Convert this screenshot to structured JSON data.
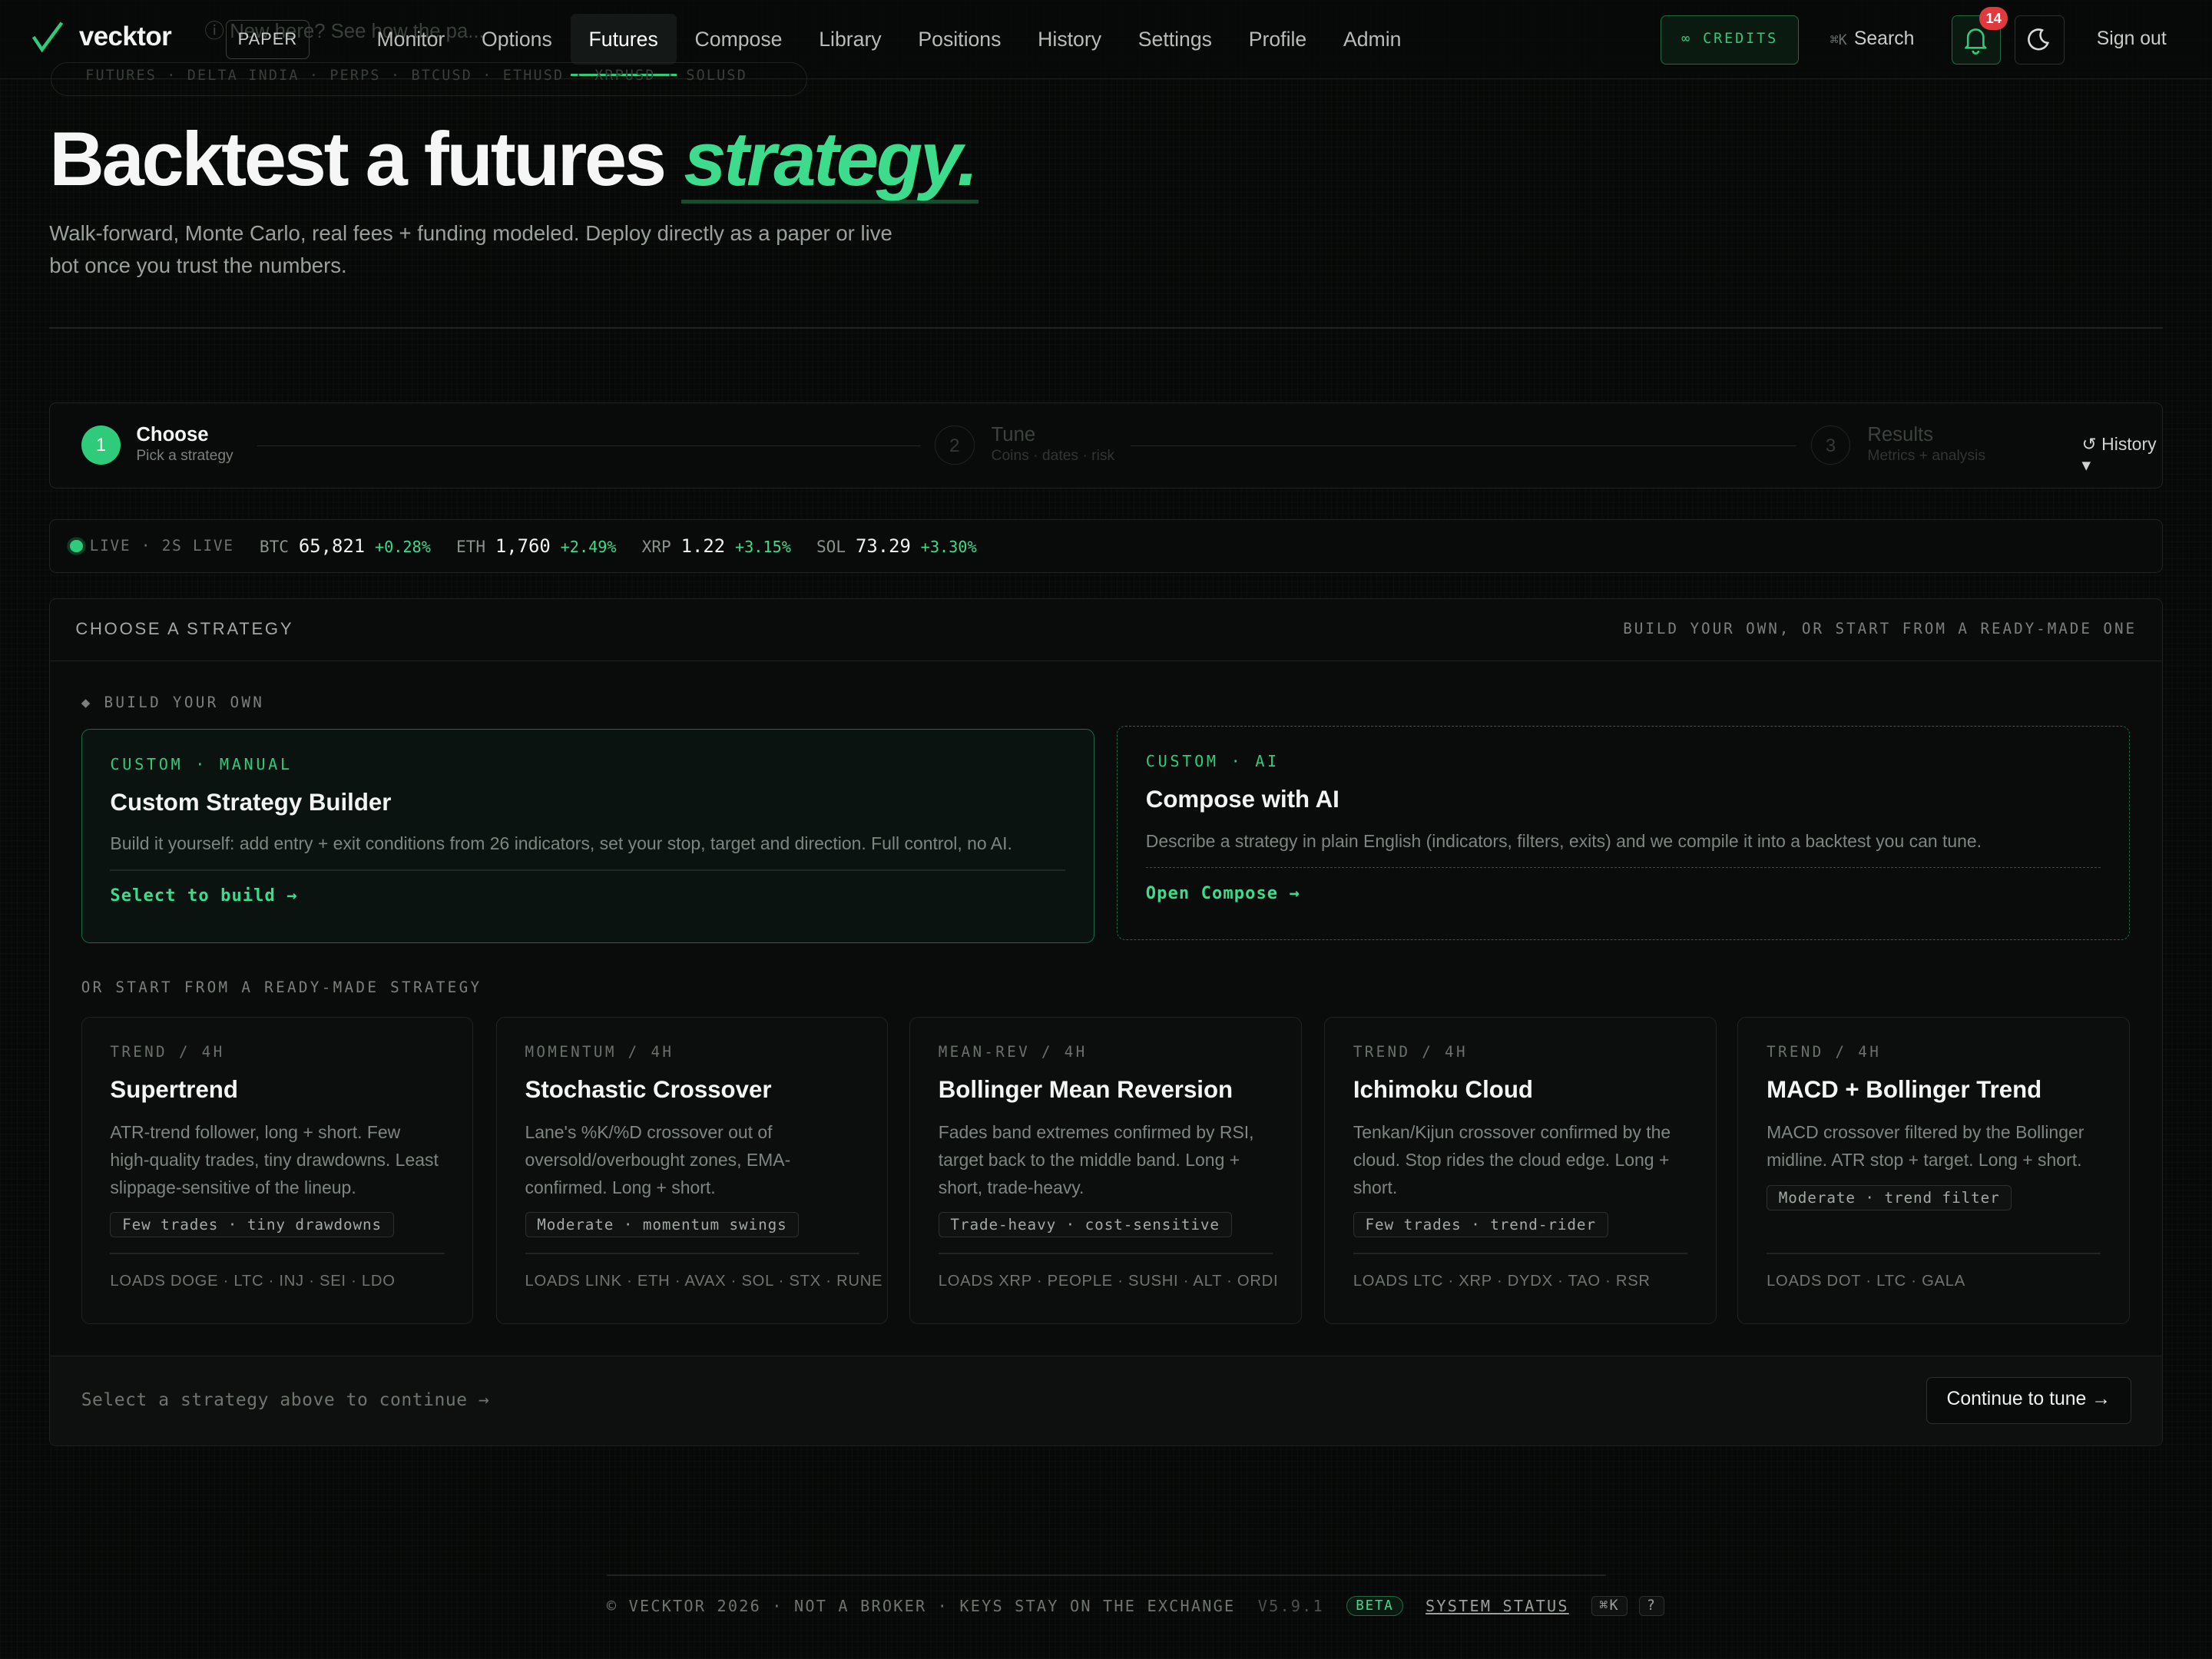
{
  "app": {
    "name": "vecktor",
    "mode_badge": "PAPER"
  },
  "nav": {
    "items": [
      {
        "label": "Monitor"
      },
      {
        "label": "Options"
      },
      {
        "label": "Futures",
        "active": true
      },
      {
        "label": "Compose"
      },
      {
        "label": "Library"
      },
      {
        "label": "Positions"
      },
      {
        "label": "History"
      },
      {
        "label": "Settings"
      },
      {
        "label": "Profile"
      },
      {
        "label": "Admin"
      }
    ],
    "credits_label": "∞ CREDITS",
    "search_shortcut": "⌘K",
    "search_label": "Search",
    "notification_count": "14",
    "signout_label": "Sign out",
    "ghost_hint": "ⓘ New here? See how the pa...",
    "ghost_strip": "FUTURES · DELTA INDIA · PERPS · BTCUSD · ETHUSD · XRPUSD · SOLUSD"
  },
  "hero": {
    "title": "Backtest a futures",
    "title_accent": "strategy.",
    "subtitle": "Walk-forward, Monte Carlo, real fees + funding modeled. Deploy directly as a paper or live bot once you trust the numbers."
  },
  "stepper": {
    "steps": [
      {
        "num": "1",
        "title": "Choose",
        "sub": "Pick a strategy",
        "state": "active"
      },
      {
        "num": "2",
        "title": "Tune",
        "sub": "Coins · dates · risk",
        "state": "pending"
      },
      {
        "num": "3",
        "title": "Results",
        "sub": "Metrics + analysis",
        "state": "pending"
      }
    ],
    "history_label": "↺ History ▾"
  },
  "ticker": {
    "live_label": "LIVE · 2S LIVE",
    "items": [
      {
        "sym": "BTC",
        "price": "65,821",
        "change": "+0.28%"
      },
      {
        "sym": "ETH",
        "price": "1,760",
        "change": "+2.49%"
      },
      {
        "sym": "XRP",
        "price": "1.22",
        "change": "+3.15%"
      },
      {
        "sym": "SOL",
        "price": "73.29",
        "change": "+3.30%"
      }
    ]
  },
  "panel": {
    "title": "CHOOSE A STRATEGY",
    "subtitle": "BUILD YOUR OWN, OR START FROM A READY-MADE ONE",
    "build_label": "◆ BUILD YOUR OWN",
    "custom_cards": [
      {
        "kicker": "CUSTOM · MANUAL",
        "title": "Custom Strategy Builder",
        "desc": "Build it yourself: add entry + exit conditions from 26 indicators, set your stop, target and direction. Full control, no AI.",
        "cta": "Select to build →"
      },
      {
        "kicker": "CUSTOM · AI",
        "title": "Compose with AI",
        "desc": "Describe a strategy in plain English (indicators, filters, exits) and we compile it into a backtest you can tune.",
        "cta": "Open Compose →"
      }
    ],
    "ready_label": "OR START FROM A READY-MADE STRATEGY",
    "strategies": [
      {
        "kicker": "TREND / 4H",
        "title": "Supertrend",
        "desc": "ATR-trend follower, long + short. Few high-quality trades, tiny drawdowns. Least slippage-sensitive of the lineup.",
        "tag": "Few trades · tiny drawdowns",
        "loads": "LOADS DOGE · LTC · INJ · SEI · LDO"
      },
      {
        "kicker": "MOMENTUM / 4H",
        "title": "Stochastic Crossover",
        "desc": "Lane's %K/%D crossover out of oversold/overbought zones, EMA-confirmed. Long + short.",
        "tag": "Moderate · momentum swings",
        "loads": "LOADS LINK · ETH · AVAX · SOL · STX · RUNE"
      },
      {
        "kicker": "MEAN-REV / 4H",
        "title": "Bollinger Mean Reversion",
        "desc": "Fades band extremes confirmed by RSI, target back to the middle band. Long + short, trade-heavy.",
        "tag": "Trade-heavy · cost-sensitive",
        "loads": "LOADS XRP · PEOPLE · SUSHI · ALT · ORDI"
      },
      {
        "kicker": "TREND / 4H",
        "title": "Ichimoku Cloud",
        "desc": "Tenkan/Kijun crossover confirmed by the cloud. Stop rides the cloud edge. Long + short.",
        "tag": "Few trades · trend-rider",
        "loads": "LOADS LTC · XRP · DYDX · TAO · RSR"
      },
      {
        "kicker": "TREND / 4H",
        "title": "MACD + Bollinger Trend",
        "desc": "MACD crossover filtered by the Bollinger midline. ATR stop + target. Long + short.",
        "tag": "Moderate · trend filter",
        "loads": "LOADS DOT · LTC · GALA"
      }
    ],
    "footer_hint": "Select a strategy above to continue →",
    "continue_label": "Continue to tune →"
  },
  "footer": {
    "text": "© VECKTOR 2026 · NOT A BROKER · KEYS STAY ON THE EXCHANGE",
    "version": "V5.9.1",
    "beta": "BETA",
    "status": "SYSTEM STATUS",
    "key1": "⌘K",
    "key2": "?"
  },
  "colors": {
    "accent": "#2ecc7a",
    "accent_text": "#3ddc8c",
    "danger": "#e0393e",
    "background": "#070908"
  }
}
